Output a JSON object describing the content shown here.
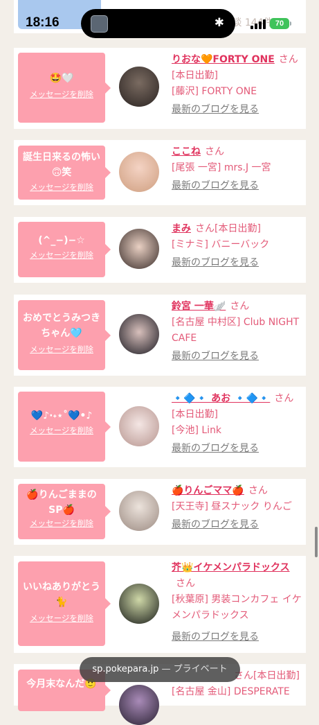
{
  "status_bar": {
    "time": "18:16",
    "battery": "70"
  },
  "top_partial": {
    "text": "[愛知県] 体験談 144件"
  },
  "cards": [
    {
      "message": "🤩🤍",
      "delete_label": "メッセージを削除",
      "name": "りおな🧡FORTY ONE",
      "san": "さん",
      "detail1": "[本日出勤]",
      "detail2": "[藤沢] FORTY ONE",
      "blog": "最新のブログを見る"
    },
    {
      "message": "誕生日来るの怖い🙃笑",
      "delete_label": "メッセージを削除",
      "name": "ここね",
      "san": "さん",
      "detail1": "[尾張 一宮] mrs.J 一宮",
      "detail2": "",
      "blog": "最新のブログを見る"
    },
    {
      "message": "(^_−)−☆",
      "delete_label": "メッセージを削除",
      "name": "まみ",
      "san": "さん",
      "detail1": "[本日出勤]",
      "detail2": "[ミナミ] バニーバック",
      "blog": "最新のブログを見る"
    },
    {
      "message": "おめでとうみつきちゃん🩵",
      "delete_label": "メッセージを削除",
      "name": "鈴宮 一華🪽",
      "san": "さん",
      "detail1": "[名古屋 中村区] Club NIGHT CAFE",
      "detail2": "",
      "blog": "最新のブログを見る"
    },
    {
      "message": "💙♪·˖⋆˚💙•♪",
      "delete_label": "メッセージを削除",
      "name": "🔹🔷🔹 あお 🔹🔷🔹",
      "san": "さん",
      "detail1": "[本日出勤]",
      "detail2": "[今池] Link",
      "blog": "最新のブログを見る"
    },
    {
      "message": "🍎りんごままのSP🍎",
      "delete_label": "メッセージを削除",
      "name": "🍎りんごママ🍎",
      "san": "さん",
      "detail1": "[天王寺] 昼スナック りんご",
      "detail2": "",
      "blog": "最新のブログを見る"
    },
    {
      "message": "いいねありがとう🐈",
      "delete_label": "メッセージを削除",
      "name": "芥👑イケメンパラドックス",
      "san": "さん",
      "detail1": "[秋葉原] 男装コンカフェ イケメンパラドックス",
      "detail2": "",
      "blog": "最新のブログを見る"
    },
    {
      "message": "今月末なんだ🙂",
      "delete_label": "",
      "name": "",
      "san": "さん",
      "detail1": "[本日出勤]",
      "detail2": "[名古屋 金山] DESPERATE",
      "blog": ""
    }
  ],
  "url_bar": {
    "domain": "sp.pokepara.jp",
    "separator": " — ",
    "mode": "プライベート"
  }
}
